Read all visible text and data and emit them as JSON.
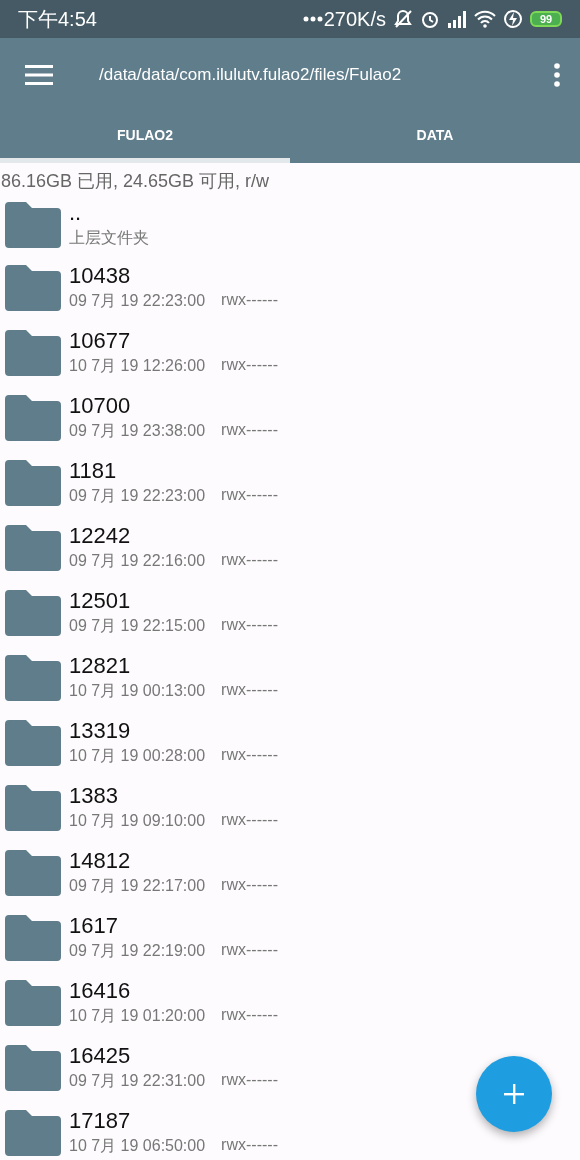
{
  "status_bar": {
    "time": "下午4:54",
    "speed": "270K/s",
    "battery": "99"
  },
  "app_bar": {
    "path": "/data/data/com.ilulutv.fulao2/files/Fulao2"
  },
  "tabs": [
    {
      "label": "FULAO2",
      "selected": true
    },
    {
      "label": "DATA",
      "selected": false
    }
  ],
  "storage_info": "86.16GB 已用, 24.65GB 可用, r/w",
  "entries": [
    {
      "kind": "parent",
      "name": "..",
      "detail": "上层文件夹"
    },
    {
      "kind": "folder",
      "name": "10438",
      "date": "09 7月 19 22:23:00",
      "permissions": "rwx------"
    },
    {
      "kind": "folder",
      "name": "10677",
      "date": "10 7月 19 12:26:00",
      "permissions": "rwx------"
    },
    {
      "kind": "folder",
      "name": "10700",
      "date": "09 7月 19 23:38:00",
      "permissions": "rwx------"
    },
    {
      "kind": "folder",
      "name": "1181",
      "date": "09 7月 19 22:23:00",
      "permissions": "rwx------"
    },
    {
      "kind": "folder",
      "name": "12242",
      "date": "09 7月 19 22:16:00",
      "permissions": "rwx------"
    },
    {
      "kind": "folder",
      "name": "12501",
      "date": "09 7月 19 22:15:00",
      "permissions": "rwx------"
    },
    {
      "kind": "folder",
      "name": "12821",
      "date": "10 7月 19 00:13:00",
      "permissions": "rwx------"
    },
    {
      "kind": "folder",
      "name": "13319",
      "date": "10 7月 19 00:28:00",
      "permissions": "rwx------"
    },
    {
      "kind": "folder",
      "name": "1383",
      "date": "10 7月 19 09:10:00",
      "permissions": "rwx------"
    },
    {
      "kind": "folder",
      "name": "14812",
      "date": "09 7月 19 22:17:00",
      "permissions": "rwx------"
    },
    {
      "kind": "folder",
      "name": "1617",
      "date": "09 7月 19 22:19:00",
      "permissions": "rwx------"
    },
    {
      "kind": "folder",
      "name": "16416",
      "date": "10 7月 19 01:20:00",
      "permissions": "rwx------"
    },
    {
      "kind": "folder",
      "name": "16425",
      "date": "09 7月 19 22:31:00",
      "permissions": "rwx------"
    },
    {
      "kind": "folder",
      "name": "17187",
      "date": "10 7月 19 06:50:00",
      "permissions": "rwx------"
    }
  ]
}
